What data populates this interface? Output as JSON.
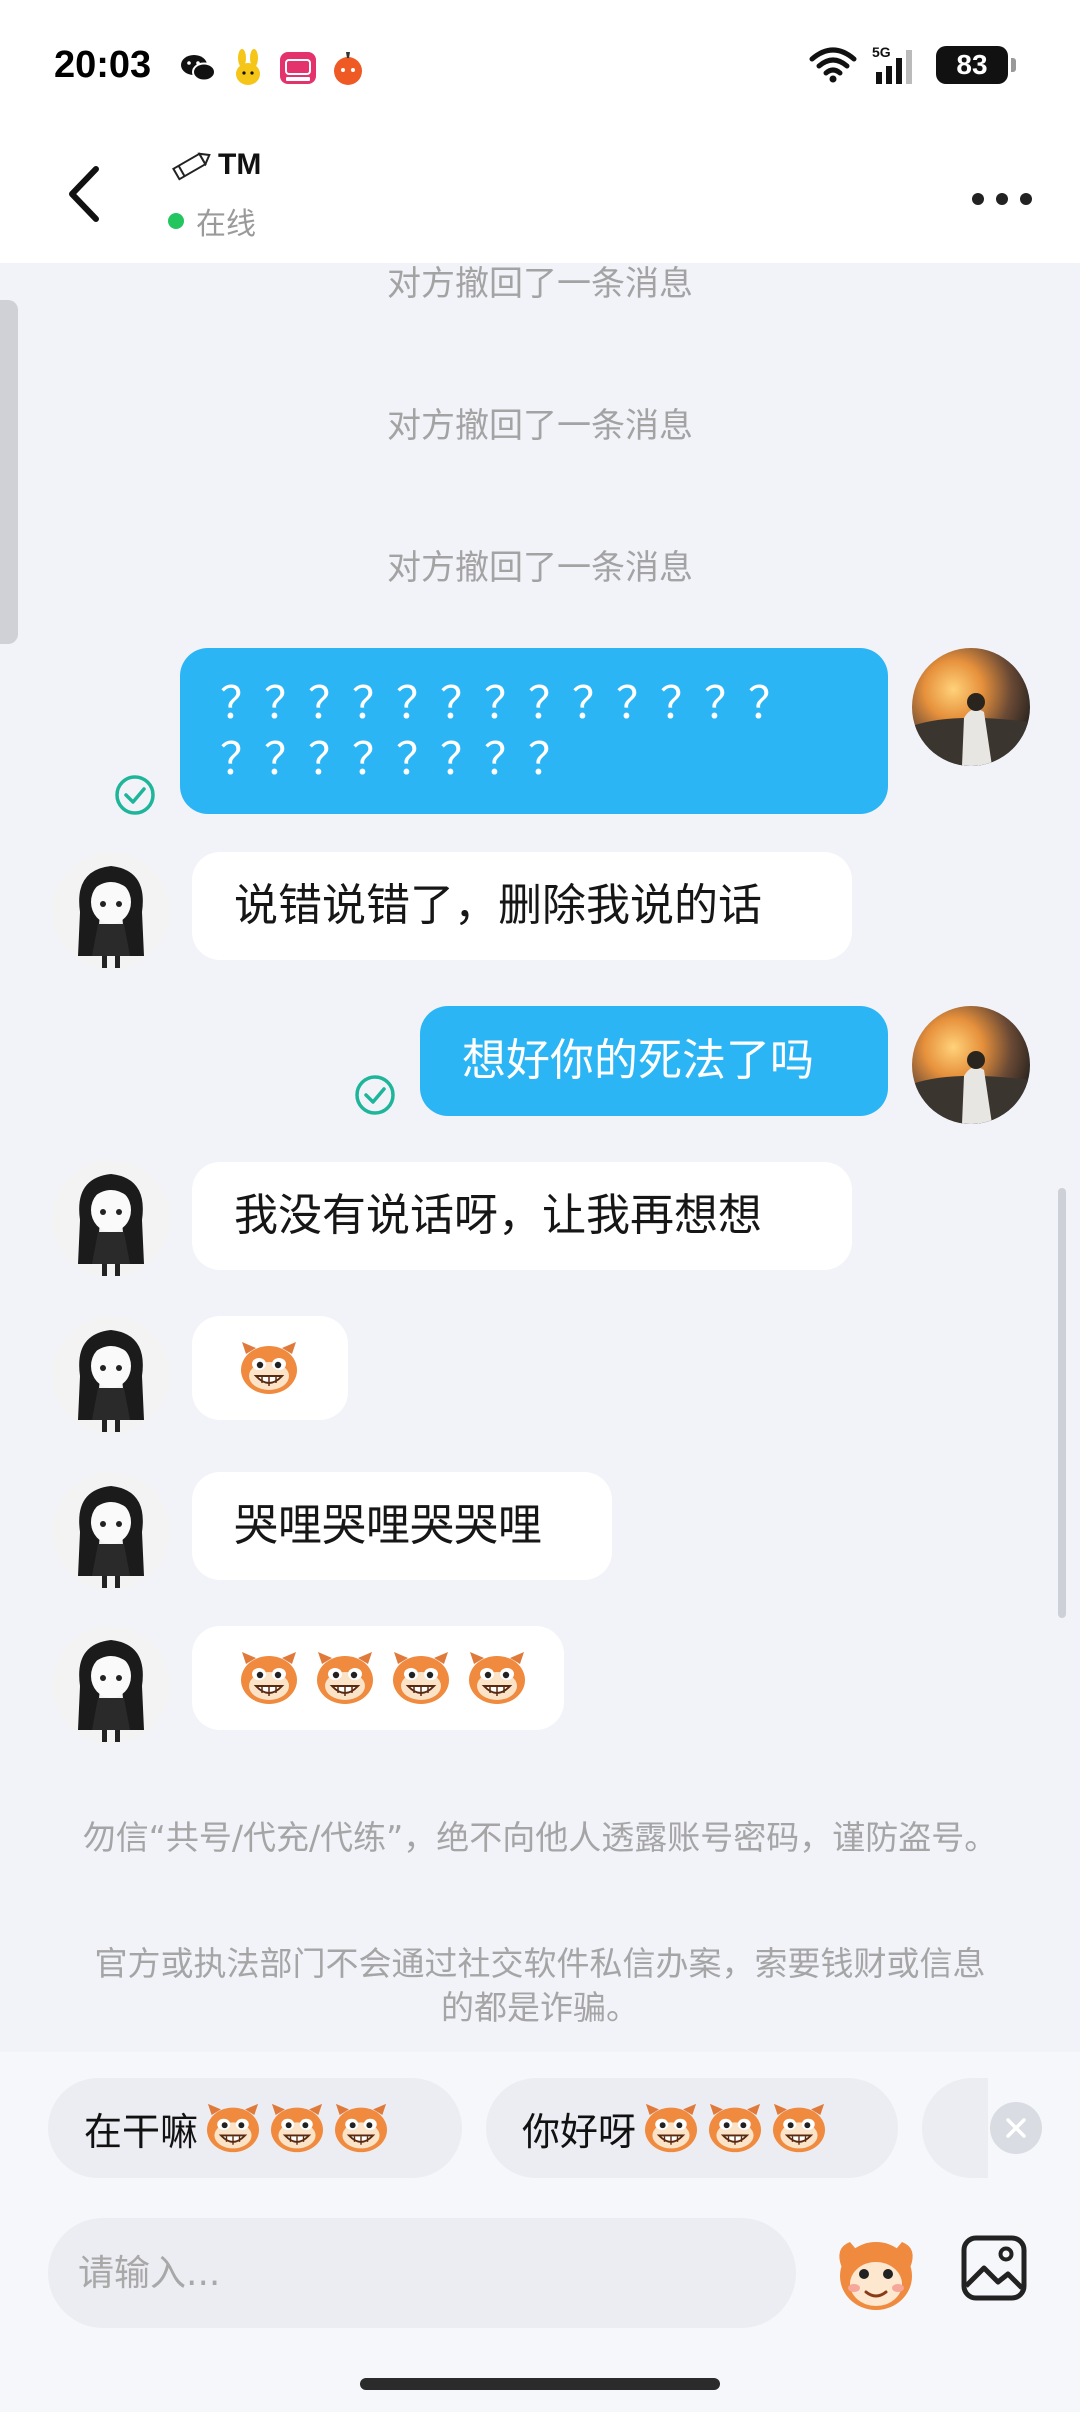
{
  "status_bar": {
    "time": "20:03",
    "battery": "83",
    "network": "5G"
  },
  "header": {
    "contact_name": "TM",
    "online_status": "在线"
  },
  "chat": {
    "recalled_notice": "对方撤回了一条消息",
    "messages": [
      {
        "side": "out",
        "text_line1": "？？？？？？？？？？？？？",
        "text_line2": "？？？？？？？？"
      },
      {
        "side": "in",
        "text": "说错说错了，删除我说的话"
      },
      {
        "side": "out",
        "text": "想好你的死法了吗"
      },
      {
        "side": "in",
        "text": "我没有说话呀，让我再想想"
      },
      {
        "side": "in",
        "type": "emoji",
        "count": 1
      },
      {
        "side": "in",
        "text": "哭哩哭哩哭哭哩"
      },
      {
        "side": "in",
        "type": "emoji",
        "count": 4
      }
    ]
  },
  "notices": {
    "line1": "勿信“共号/代充/代练”，绝不向他人透露账号密码，谨防盗号。",
    "line2": "官方或执法部门不会通过社交软件私信办案，索要钱财或信息的都是诈骗。"
  },
  "quick_replies": [
    {
      "label": "在干嘛",
      "emoji_count": 3
    },
    {
      "label": "你好呀",
      "emoji_count": 3
    }
  ],
  "input": {
    "placeholder": "请输入..."
  },
  "colors": {
    "outgoing_bubble": "#2cb5f5",
    "incoming_bubble": "#ffffff",
    "online": "#22c55e",
    "check": "#1fb59a"
  }
}
